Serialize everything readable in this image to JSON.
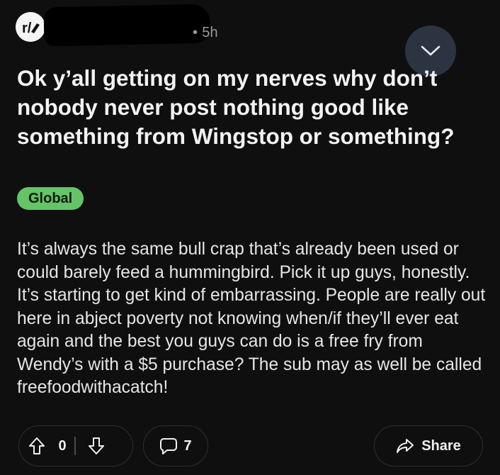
{
  "post": {
    "subreddit_icon": "subreddit-avatar-icon",
    "time_ago": "5h",
    "separator": "•",
    "title": "Ok y’all getting on my nerves why don’t nobody never post nothing good like something from Wingstop or something?",
    "flair": "Global",
    "body": "It’s always the same bull crap that’s already been used or could barely feed a hummingbird. Pick it up guys, honestly. It’s starting to get kind of embarrassing. People are really out here in abject poverty not knowing when/if they’ll ever eat again and the best you guys can do is a free fry from Wendy’s with a $5 purchase? The sub may as well be called freefoodwithacatch!"
  },
  "actions": {
    "vote_count": "0",
    "comment_count": "7",
    "share_label": "Share"
  },
  "colors": {
    "background": "#0f0f0f",
    "flair_green": "#65c466",
    "menu_button": "#2b3440"
  },
  "icons": {
    "menu": "chevron-down-icon",
    "upvote": "upvote-arrow-icon",
    "downvote": "downvote-arrow-icon",
    "comments": "comment-bubble-icon",
    "share": "share-arrow-icon"
  }
}
